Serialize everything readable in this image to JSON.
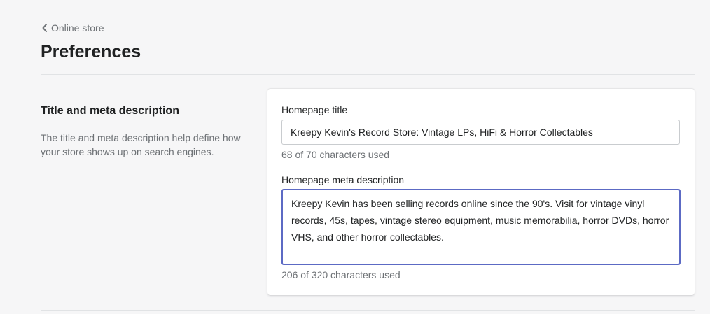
{
  "header": {
    "breadcrumb_label": "Online store",
    "page_title": "Preferences"
  },
  "section": {
    "heading": "Title and meta description",
    "description": "The title and meta description help define how your store shows up on search engines."
  },
  "form": {
    "homepage_title": {
      "label": "Homepage title",
      "value": "Kreepy Kevin's Record Store: Vintage LPs, HiFi & Horror Collectables",
      "char_count_text": "68 of 70 characters used"
    },
    "homepage_meta_description": {
      "label": "Homepage meta description",
      "value": "Kreepy Kevin has been selling records online since the 90's. Visit for vintage vinyl records, 45s, tapes, vintage stereo equipment, music memorabilia, horror DVDs, horror VHS, and other horror collectables.",
      "char_count_text": "206 of 320 characters used"
    }
  },
  "colors": {
    "background": "#f6f6f7",
    "focus_border": "#5c6ac4",
    "subdued_text": "#6d7175"
  },
  "icons": {
    "breadcrumb": "chevron-left-icon"
  }
}
